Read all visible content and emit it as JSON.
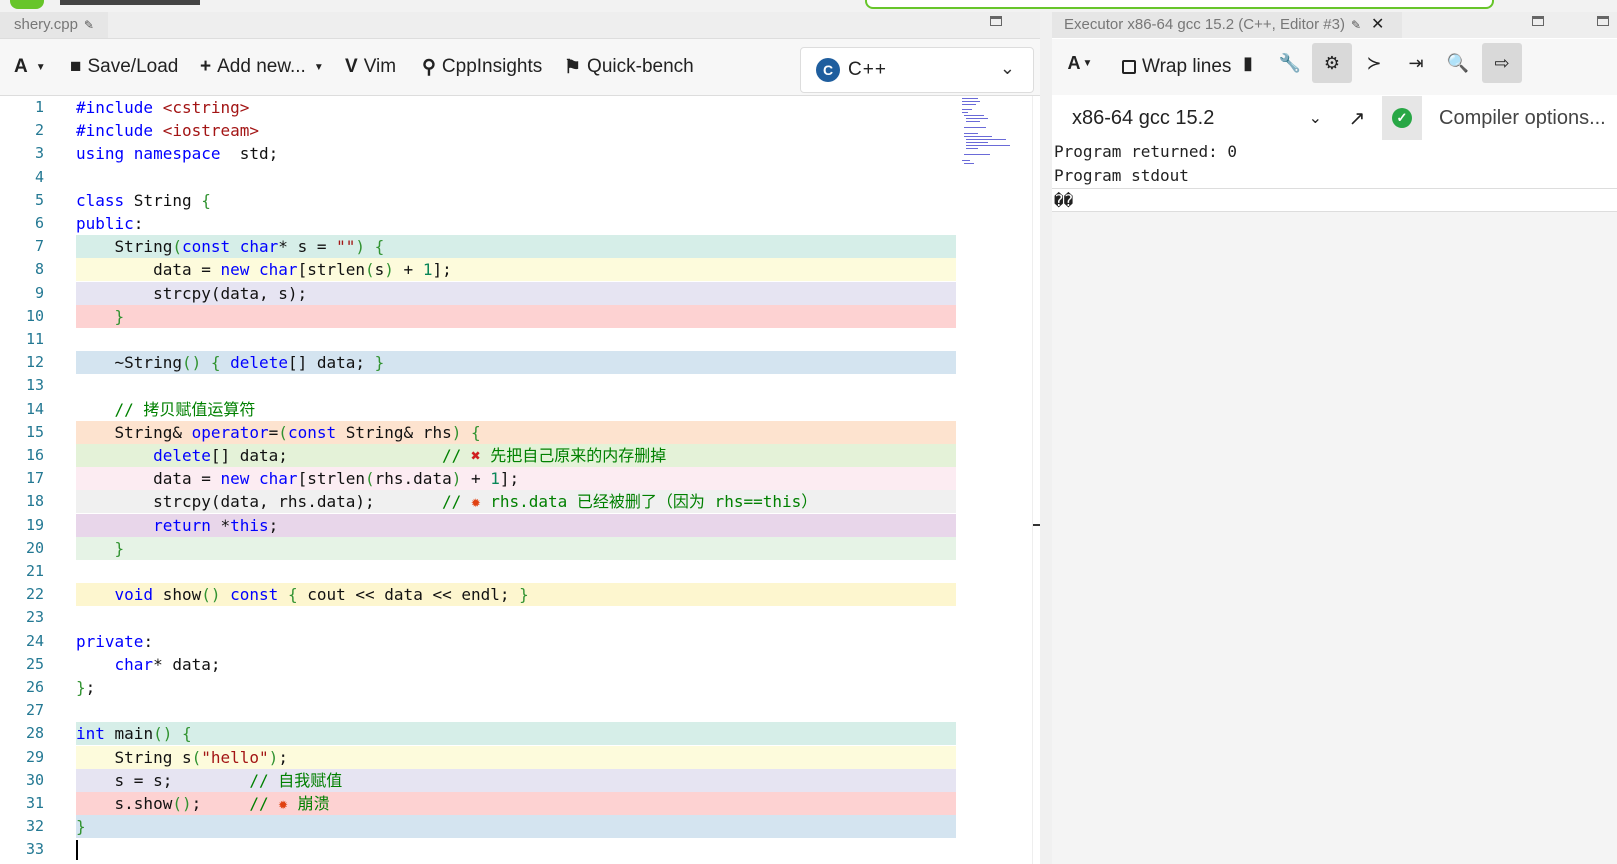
{
  "editor": {
    "tab_title": "shery.cpp",
    "toolbar": {
      "save_load": "Save/Load",
      "add_new": "Add new...",
      "vim": "Vim",
      "cppinsights": "CppInsights",
      "quick_bench": "Quick-bench",
      "language": "C++"
    },
    "lines": [
      {
        "n": "1",
        "tokens": [
          [
            "pp",
            "#include "
          ],
          [
            "str",
            "<cstring>"
          ]
        ]
      },
      {
        "n": "2",
        "tokens": [
          [
            "pp",
            "#include "
          ],
          [
            "str",
            "<iostream>"
          ]
        ]
      },
      {
        "n": "3",
        "tokens": [
          [
            "kw",
            "using namespace"
          ],
          [
            "",
            "  std;"
          ]
        ]
      },
      {
        "n": "4",
        "tokens": []
      },
      {
        "n": "5",
        "tokens": [
          [
            "kw",
            "class"
          ],
          [
            "",
            " String "
          ],
          [
            "br",
            "{"
          ]
        ]
      },
      {
        "n": "6",
        "tokens": [
          [
            "kw",
            "public"
          ],
          [
            "",
            ":"
          ]
        ]
      },
      {
        "n": "7",
        "hl": "#d6eee8",
        "tokens": [
          [
            "",
            "    String"
          ],
          [
            "br",
            "("
          ],
          [
            "kw",
            "const char"
          ],
          [
            "",
            "* s = "
          ],
          [
            "str",
            "\"\""
          ],
          [
            "br",
            ")"
          ],
          [
            "",
            " "
          ],
          [
            "br",
            "{"
          ]
        ]
      },
      {
        "n": "8",
        "hl": "#fdfbdc",
        "tokens": [
          [
            "",
            "        data = "
          ],
          [
            "kw",
            "new char"
          ],
          [
            "",
            "[strlen"
          ],
          [
            "br",
            "("
          ],
          [
            "",
            "s"
          ],
          [
            "br",
            ")"
          ],
          [
            "",
            " + "
          ],
          [
            "num",
            "1"
          ],
          [
            "",
            "];"
          ]
        ]
      },
      {
        "n": "9",
        "hl": "#e6e4f2",
        "tokens": [
          [
            "",
            "        strcpy(data, s);"
          ]
        ]
      },
      {
        "n": "10",
        "hl": "#fdd2d2",
        "tokens": [
          [
            "",
            "    "
          ],
          [
            "br",
            "}"
          ]
        ]
      },
      {
        "n": "11",
        "tokens": []
      },
      {
        "n": "12",
        "hl": "#d4e4f0",
        "tokens": [
          [
            "",
            "    ~String"
          ],
          [
            "br",
            "()"
          ],
          [
            "",
            " "
          ],
          [
            "br",
            "{"
          ],
          [
            "",
            " "
          ],
          [
            "kw",
            "delete"
          ],
          [
            "",
            "[] data; "
          ],
          [
            "br",
            "}"
          ]
        ]
      },
      {
        "n": "13",
        "tokens": []
      },
      {
        "n": "14",
        "tokens": [
          [
            "com",
            "    // 拷贝赋值运算符"
          ]
        ]
      },
      {
        "n": "15",
        "hl": "#fde3cf",
        "tokens": [
          [
            "",
            "    String& "
          ],
          [
            "kw",
            "operator"
          ],
          [
            "",
            "="
          ],
          [
            "br",
            "("
          ],
          [
            "kw",
            "const"
          ],
          [
            "",
            " String& rhs"
          ],
          [
            "br",
            ")"
          ],
          [
            "",
            " "
          ],
          [
            "br",
            "{"
          ]
        ]
      },
      {
        "n": "16",
        "hl": "#e4f2d8",
        "tokens": [
          [
            "",
            "        "
          ],
          [
            "kw",
            "delete"
          ],
          [
            "",
            "[] data;                "
          ],
          [
            "com",
            "// "
          ],
          [
            "x",
            "✖"
          ],
          [
            "com",
            " 先把自己原来的内存删掉"
          ]
        ]
      },
      {
        "n": "17",
        "hl": "#fcecf2",
        "tokens": [
          [
            "",
            "        data = "
          ],
          [
            "kw",
            "new char"
          ],
          [
            "",
            "[strlen"
          ],
          [
            "br",
            "("
          ],
          [
            "",
            "rhs.data"
          ],
          [
            "br",
            ")"
          ],
          [
            "",
            " + "
          ],
          [
            "num",
            "1"
          ],
          [
            "",
            "];"
          ]
        ]
      },
      {
        "n": "18",
        "hl": "#f0f0f0",
        "tokens": [
          [
            "",
            "        strcpy(data, rhs.data);       "
          ],
          [
            "com",
            "// "
          ],
          [
            "boom",
            "✹"
          ],
          [
            "com",
            " rhs.data 已经被删了（因为 rhs==this）"
          ]
        ]
      },
      {
        "n": "19",
        "hl": "#e8d6ea",
        "tokens": [
          [
            "",
            "        "
          ],
          [
            "kw",
            "return"
          ],
          [
            "",
            " *"
          ],
          [
            "kw",
            "this"
          ],
          [
            "",
            ";"
          ]
        ]
      },
      {
        "n": "20",
        "hl": "#e6f3e6",
        "tokens": [
          [
            "",
            "    "
          ],
          [
            "br",
            "}"
          ]
        ]
      },
      {
        "n": "21",
        "tokens": []
      },
      {
        "n": "22",
        "hl": "#fdf6cf",
        "tokens": [
          [
            "",
            "    "
          ],
          [
            "kw",
            "void"
          ],
          [
            "",
            " show"
          ],
          [
            "br",
            "()"
          ],
          [
            "",
            " "
          ],
          [
            "kw",
            "const"
          ],
          [
            "",
            " "
          ],
          [
            "br",
            "{"
          ],
          [
            "",
            " cout << data << endl; "
          ],
          [
            "br",
            "}"
          ]
        ]
      },
      {
        "n": "23",
        "tokens": []
      },
      {
        "n": "24",
        "tokens": [
          [
            "kw",
            "private"
          ],
          [
            "",
            ":"
          ]
        ]
      },
      {
        "n": "25",
        "tokens": [
          [
            "",
            "    "
          ],
          [
            "kw",
            "char"
          ],
          [
            "",
            "* data;"
          ]
        ]
      },
      {
        "n": "26",
        "tokens": [
          [
            "br",
            "}"
          ],
          [
            "",
            ";"
          ]
        ]
      },
      {
        "n": "27",
        "tokens": []
      },
      {
        "n": "28",
        "hl": "#d6eee8",
        "tokens": [
          [
            "kw",
            "int"
          ],
          [
            "",
            " main"
          ],
          [
            "br",
            "()"
          ],
          [
            "",
            " "
          ],
          [
            "br",
            "{"
          ]
        ]
      },
      {
        "n": "29",
        "hl": "#fdfbdc",
        "tokens": [
          [
            "",
            "    String s"
          ],
          [
            "br",
            "("
          ],
          [
            "str",
            "\"hello\""
          ],
          [
            "br",
            ")"
          ],
          [
            "",
            ";"
          ]
        ]
      },
      {
        "n": "30",
        "hl": "#e6e4f2",
        "tokens": [
          [
            "",
            "    s = s;        "
          ],
          [
            "com",
            "// 自我赋值"
          ]
        ]
      },
      {
        "n": "31",
        "hl": "#fdd2d2",
        "tokens": [
          [
            "",
            "    s.show"
          ],
          [
            "br",
            "()"
          ],
          [
            "",
            ";     "
          ],
          [
            "com",
            "// "
          ],
          [
            "boom",
            "✹"
          ],
          [
            "com",
            " 崩溃"
          ]
        ]
      },
      {
        "n": "32",
        "hl": "#d4e4f0",
        "tokens": [
          [
            "br",
            "}"
          ]
        ]
      },
      {
        "n": "33",
        "tokens": []
      }
    ]
  },
  "executor": {
    "tab_title": "Executor x86-64 gcc 15.2 (C++, Editor #3)",
    "wrap_lines": "Wrap lines",
    "compiler": "x86-64 gcc 15.2",
    "compiler_options": "Compiler options...",
    "output": {
      "returned": "Program returned: 0",
      "stdout_label": "Program stdout",
      "stdout_text": "��"
    }
  },
  "colors": {
    "keyword": "#0000ff",
    "string": "#a31515",
    "comment": "#008000",
    "line_number": "#237893",
    "success": "#28a745"
  }
}
